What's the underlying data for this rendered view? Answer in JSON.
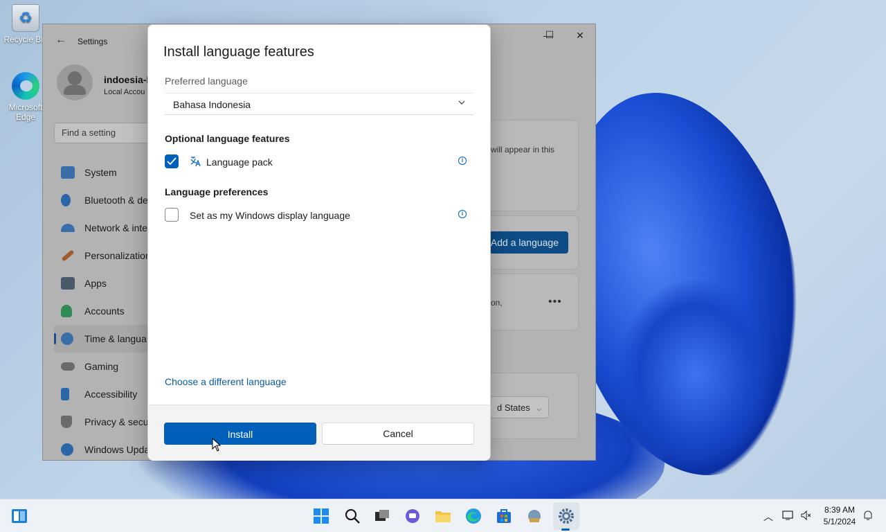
{
  "desktop": {
    "icons": [
      {
        "label": "Recycle Bin"
      },
      {
        "label": "Microsoft Edge"
      }
    ]
  },
  "settings_window": {
    "title": "Settings",
    "user_name": "indoesia-F",
    "user_sub": "Local Accou",
    "search_placeholder": "Find a setting",
    "nav": [
      {
        "label": "System",
        "color": "#3a6ea8"
      },
      {
        "label": "Bluetooth & de",
        "color": "#2a66a8"
      },
      {
        "label": "Network & inte",
        "color": "#3a6ea8"
      },
      {
        "label": "Personalization",
        "color": "#a05a2c"
      },
      {
        "label": "Apps",
        "color": "#4a5a6a"
      },
      {
        "label": "Accounts",
        "color": "#2f8a55"
      },
      {
        "label": "Time & langua",
        "color": "#3a6ea8"
      },
      {
        "label": "Gaming",
        "color": "#6a6a6a"
      },
      {
        "label": "Accessibility",
        "color": "#2a66a8"
      },
      {
        "label": "Privacy & secu",
        "color": "#6a6a6a"
      },
      {
        "label": "Windows Upda",
        "color": "#2a66a8"
      }
    ],
    "card1_text_a": "will appear in this",
    "add_language": "Add a language",
    "card2_text": "on,",
    "region_select": "d States"
  },
  "dialog": {
    "title": "Install language features",
    "preferred_label": "Preferred language",
    "preferred_value": "Bahasa Indonesia",
    "optional_heading": "Optional language features",
    "language_pack": "Language pack",
    "language_pack_checked": true,
    "prefs_heading": "Language preferences",
    "display_language": "Set as my Windows display language",
    "display_language_checked": false,
    "choose_link": "Choose a different language",
    "install": "Install",
    "cancel": "Cancel"
  },
  "taskbar": {
    "time": "8:39 AM",
    "date": "5/1/2024",
    "accent": "#005fb8"
  }
}
